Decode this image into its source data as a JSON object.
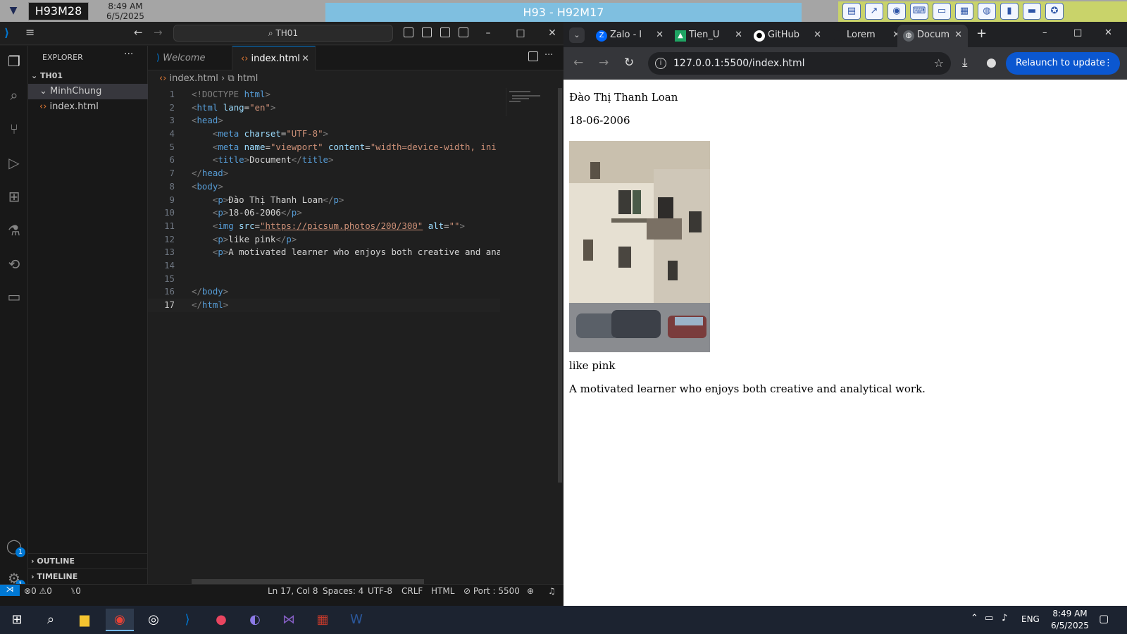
{
  "topstrip": {
    "session_id": "H93M28",
    "time": "8:49 AM",
    "date": "6/5/2025",
    "title": "H93 - H92M17",
    "tool_icons": [
      "document-icon",
      "chart-icon",
      "disc-icon",
      "keyboard-icon",
      "printer-icon",
      "window-icon",
      "globe-icon",
      "book-icon",
      "message-icon",
      "lifebuoy-icon"
    ]
  },
  "vscode": {
    "search_text": "TH01",
    "explorer": {
      "header": "EXPLORER",
      "root": "TH01",
      "folder": "MinhChung",
      "file": "index.html",
      "outline": "OUTLINE",
      "timeline": "TIMELINE"
    },
    "tabs": [
      {
        "label": "Welcome"
      },
      {
        "label": "index.html"
      }
    ],
    "breadcrumb": {
      "file": "index.html",
      "node": "html"
    },
    "code_lines": [
      {
        "n": "1"
      },
      {
        "n": "2"
      },
      {
        "n": "3"
      },
      {
        "n": "4"
      },
      {
        "n": "5"
      },
      {
        "n": "6"
      },
      {
        "n": "7"
      },
      {
        "n": "8"
      },
      {
        "n": "9"
      },
      {
        "n": "10"
      },
      {
        "n": "11"
      },
      {
        "n": "12"
      },
      {
        "n": "13"
      },
      {
        "n": "14"
      },
      {
        "n": "15"
      },
      {
        "n": "16"
      },
      {
        "n": "17"
      }
    ],
    "code": {
      "l1a": "<!DOCTYPE ",
      "l1b": "html",
      "l1c": ">",
      "l2a": "<",
      "l2b": "html",
      "l2c": " lang",
      "l2d": "=",
      "l2e": "\"en\"",
      "l2f": ">",
      "l3a": "<",
      "l3b": "head",
      "l3c": ">",
      "l4a": "    <",
      "l4b": "meta",
      "l4c": " charset",
      "l4d": "=",
      "l4e": "\"UTF-8\"",
      "l4f": ">",
      "l5a": "    <",
      "l5b": "meta",
      "l5c": " name",
      "l5d": "=",
      "l5e": "\"viewport\"",
      "l5f": " content",
      "l5g": "=",
      "l5h": "\"width=device-width, ini",
      "l6a": "    <",
      "l6b": "title",
      "l6c": ">",
      "l6d": "Document",
      "l6e": "</",
      "l6f": "title",
      "l6g": ">",
      "l7a": "</",
      "l7b": "head",
      "l7c": ">",
      "l8a": "<",
      "l8b": "body",
      "l8c": ">",
      "l9a": "    <",
      "l9b": "p",
      "l9c": ">",
      "l9d": "Đào Thị Thanh Loan",
      "l9e": "</",
      "l9f": "p",
      "l9g": ">",
      "l10a": "    <",
      "l10b": "p",
      "l10c": ">",
      "l10d": "18-06-2006",
      "l10e": "</",
      "l10f": "p",
      "l10g": ">",
      "l11a": "    <",
      "l11b": "img",
      "l11c": " src",
      "l11d": "=",
      "l11e": "\"https://picsum.photos/200/300\"",
      "l11f": " alt",
      "l11g": "=",
      "l11h": "\"\"",
      "l11i": ">",
      "l12a": "    <",
      "l12b": "p",
      "l12c": ">",
      "l12d": "like pink",
      "l12e": "</",
      "l12f": "p",
      "l12g": ">",
      "l13a": "    <",
      "l13b": "p",
      "l13c": ">",
      "l13d": "A motivated learner who enjoys both creative and ana",
      "l16a": "</",
      "l16b": "body",
      "l16c": ">",
      "l17a": "</",
      "l17b": "html",
      "l17c": ">"
    },
    "status": {
      "errors": "0",
      "warnings": "0",
      "ports": "0",
      "position": "Ln 17, Col 8",
      "spaces": "Spaces: 4",
      "encoding": "UTF-8",
      "eol": "CRLF",
      "language": "HTML",
      "port": "Port : 5500"
    },
    "accounts_badge": "1",
    "settings_badge": "1"
  },
  "chrome": {
    "tabs": [
      {
        "label": "Zalo - l"
      },
      {
        "label": "Tien_U"
      },
      {
        "label": "GitHub"
      },
      {
        "label": "Lorem"
      },
      {
        "label": "Docum"
      }
    ],
    "url": "127.0.0.1:5500/index.html",
    "relaunch": "Relaunch to update"
  },
  "page": {
    "name": "Đào Thị Thanh Loan",
    "date": "18-06-2006",
    "like": "like pink",
    "bio": "A motivated learner who enjoys both creative and analytical work."
  },
  "taskbar": {
    "language": "ENG",
    "time": "8:49 AM",
    "date": "6/5/2025"
  },
  "colors": {
    "accent": "#0078d4",
    "relaunch": "#0b57d0",
    "title_bar": "#7fbfe0"
  }
}
